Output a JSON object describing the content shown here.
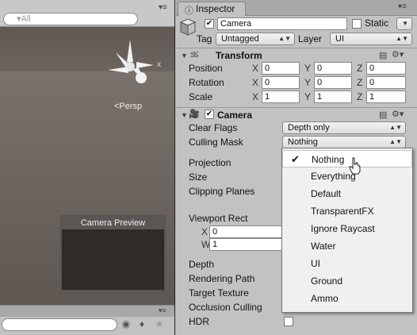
{
  "scene": {
    "search_placeholder": "▾All",
    "persp_label": "<Persp",
    "preview_title": "Camera Preview",
    "gizmo_axis_label": "x"
  },
  "inspector": {
    "tab_label": "Inspector",
    "object_name": "Camera",
    "static_label": "Static",
    "tag_label": "Tag",
    "tag_value": "Untagged",
    "layer_label": "Layer",
    "layer_value": "UI"
  },
  "transform": {
    "title": "Transform",
    "rows": [
      {
        "label": "Position",
        "x": "0",
        "y": "0",
        "z": "0"
      },
      {
        "label": "Rotation",
        "x": "0",
        "y": "0",
        "z": "0"
      },
      {
        "label": "Scale",
        "x": "1",
        "y": "1",
        "z": "1"
      }
    ]
  },
  "camera": {
    "title": "Camera",
    "clear_flags_label": "Clear Flags",
    "clear_flags_value": "Depth only",
    "culling_mask_label": "Culling Mask",
    "culling_mask_value": "Nothing",
    "projection_label": "Projection",
    "size_label": "Size",
    "clipping_label": "Clipping Planes",
    "viewport_label": "Viewport Rect",
    "viewport_x_label": "X",
    "viewport_x": "0",
    "viewport_w_label": "W",
    "viewport_w": "1",
    "depth_label": "Depth",
    "rendering_path_label": "Rendering Path",
    "target_texture_label": "Target Texture",
    "occlusion_label": "Occlusion Culling",
    "hdr_label": "HDR"
  },
  "mask_menu": {
    "items": [
      "Nothing",
      "Everything",
      "Default",
      "TransparentFX",
      "Ignore Raycast",
      "Water",
      "UI",
      "Ground",
      "Ammo"
    ],
    "checked_index": 0,
    "highlight_index": 0
  },
  "icons": {
    "search": "search-icon",
    "menu": "panel-menu-icon",
    "cube": "gameobject-cube-icon",
    "transform": "transform-icon",
    "camera": "camera-component-icon",
    "settings": "gear-icon",
    "help": "help-book-icon"
  }
}
